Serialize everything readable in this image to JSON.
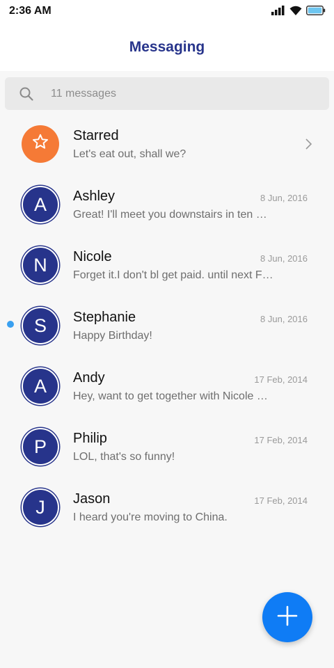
{
  "status_bar": {
    "time": "2:36 AM"
  },
  "header": {
    "title": "Messaging"
  },
  "search": {
    "placeholder": "11 messages"
  },
  "conversations": [
    {
      "avatar": "star-icon",
      "name": "Starred",
      "preview": "Let's eat out, shall we?",
      "date": "",
      "starred": true,
      "unread": false
    },
    {
      "avatar": "A",
      "name": "Ashley",
      "preview": "Great! I'll meet you downstairs in ten …",
      "date": "8 Jun, 2016",
      "starred": false,
      "unread": false
    },
    {
      "avatar": "N",
      "name": "Nicole",
      "preview": "Forget it.I don't bl get paid. until next F…",
      "date": "8 Jun, 2016",
      "starred": false,
      "unread": false
    },
    {
      "avatar": "S",
      "name": "Stephanie",
      "preview": "Happy Birthday!",
      "date": "8 Jun, 2016",
      "starred": false,
      "unread": true
    },
    {
      "avatar": "A",
      "name": "Andy",
      "preview": "Hey, want to get together with Nicole …",
      "date": "17 Feb, 2014",
      "starred": false,
      "unread": false
    },
    {
      "avatar": "P",
      "name": "Philip",
      "preview": "LOL, that's so funny!",
      "date": "17 Feb, 2014",
      "starred": false,
      "unread": false
    },
    {
      "avatar": "J",
      "name": "Jason",
      "preview": "I heard you're moving to China.",
      "date": "17 Feb, 2014",
      "starred": false,
      "unread": false
    }
  ],
  "fab": {
    "icon": "plus-icon"
  },
  "colors": {
    "accent": "#27348b",
    "starred_avatar": "#f57a36",
    "fab": "#0f7cf5",
    "unread_dot": "#3aa0f0"
  }
}
